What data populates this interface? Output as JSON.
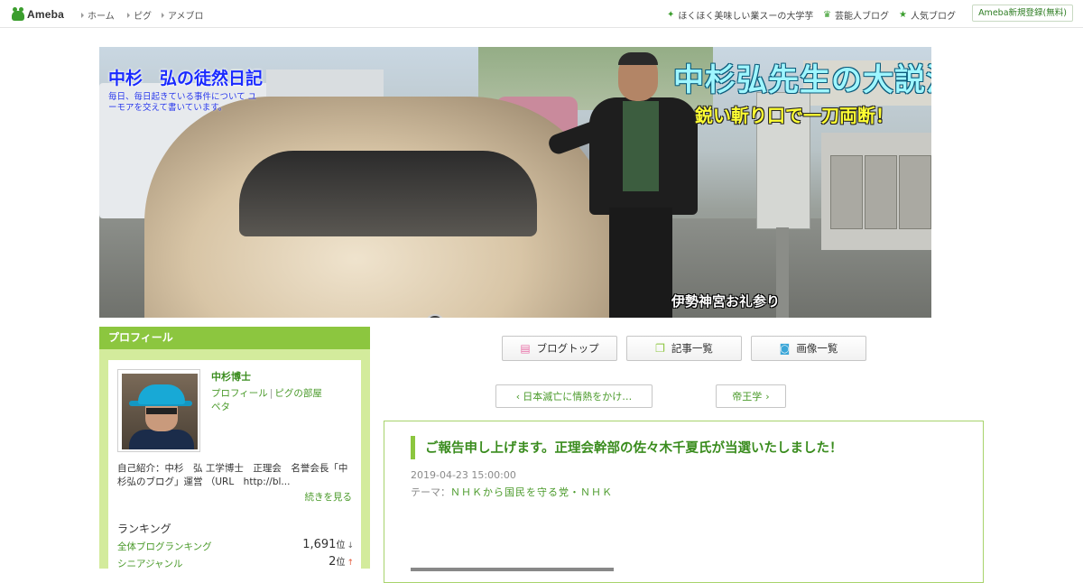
{
  "topbar": {
    "logo_text": "Ameba",
    "nav": [
      "ホーム",
      "ピグ",
      "アメブロ"
    ],
    "right_nav": [
      {
        "icon": "sparkle-icon",
        "label": "ほくほく美味しい業スーの大学芋"
      },
      {
        "icon": "crown-icon",
        "label": "芸能人ブログ"
      },
      {
        "icon": "star-icon",
        "label": "人気ブログ"
      }
    ],
    "signup_label": "Ameba新規登録(無料)"
  },
  "header": {
    "title": "中杉　弘の徒然日記",
    "description": "毎日、毎日起きている事件について ユーモアを交えて書いています。",
    "banner_title": "中杉弘先生の大説法",
    "banner_subtitle": "鋭い斬り口で一刀両断！",
    "banner_caption": "伊勢神宮お礼参り"
  },
  "sidebar": {
    "heading": "プロフィール",
    "name": "中杉博士",
    "links": [
      "プロフィール",
      "ピグの部屋",
      "ペタ"
    ],
    "intro": "自己紹介：中杉　弘 工学博士　正理会　名誉会長「中杉弘のブログ」運営 （URL　http://bl...",
    "more_label": "続きを見る",
    "ranking_title": "ランキング",
    "rankings": [
      {
        "label": "全体ブログランキング",
        "value": "1,691",
        "unit": "位",
        "trend": "↓"
      },
      {
        "label": "シニアジャンル",
        "value": "2",
        "unit": "位",
        "trend": "↑"
      }
    ]
  },
  "main": {
    "buttons": [
      {
        "icon": "document-icon",
        "label": "ブログトップ"
      },
      {
        "icon": "copy-icon",
        "label": "記事一覧"
      },
      {
        "icon": "camera-icon",
        "label": "画像一覧"
      }
    ],
    "prev_label": "日本滅亡に情熱をかけ…",
    "next_label": "帝王学",
    "article": {
      "title": "ご報告申し上げます。正理会幹部の佐々木千夏氏が当選いたしました！",
      "date": "2019-04-23 15:00:00",
      "theme_prefix": "テーマ：",
      "theme": "ＮＨＫから国民を守る党・ＮＨＫ"
    }
  },
  "colors": {
    "brand_green": "#8cc63f",
    "link_green": "#4a9a2a",
    "title_blue": "#1a2aff"
  }
}
